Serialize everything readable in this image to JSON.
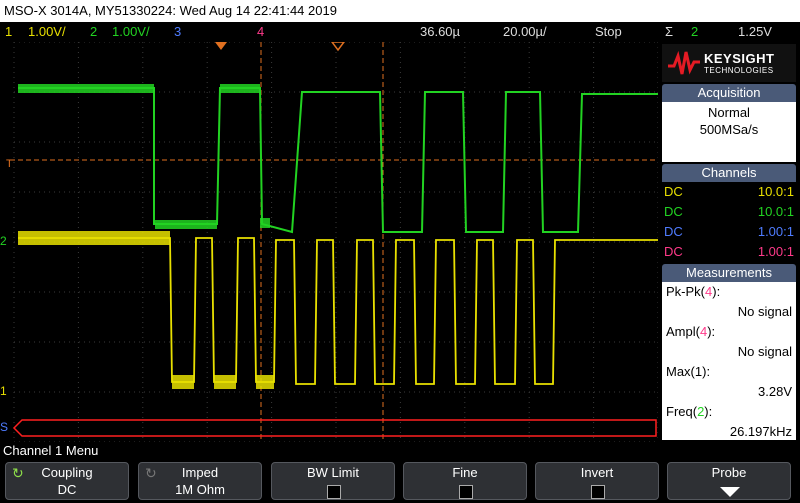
{
  "title": "MSO-X 3014A, MY51330224: Wed Aug 14 22:41:44 2019",
  "status": {
    "ch1_num": "1",
    "ch1_scale": "1.00V/",
    "ch2_num": "2",
    "ch2_scale": "1.00V/",
    "ch3_num": "3",
    "ch4_num": "4",
    "time_pos": "36.60µ",
    "time_scale": "20.00µ/",
    "run_state": "Stop",
    "trigger_icon": "Σ",
    "trigger_src": "2",
    "trigger_level": "1.25V"
  },
  "markers": {
    "trig": "T",
    "ch2": "2",
    "ch1": "1",
    "serial": "S"
  },
  "logo": {
    "brand": "KEYSIGHT",
    "sub": "TECHNOLOGIES",
    "icon": "keysight-wave-icon"
  },
  "acquisition": {
    "header": "Acquisition",
    "mode": "Normal",
    "rate": "500MSa/s"
  },
  "channels": {
    "header": "Channels",
    "rows": [
      {
        "coupling": "DC",
        "probe": "10.0:1",
        "color": "#e8e000"
      },
      {
        "coupling": "DC",
        "probe": "10.0:1",
        "color": "#22d322"
      },
      {
        "coupling": "DC",
        "probe": "1.00:1",
        "color": "#4f7cff"
      },
      {
        "coupling": "DC",
        "probe": "1.00:1",
        "color": "#ff3a8a"
      }
    ]
  },
  "measurements": {
    "header": "Measurements",
    "items": [
      {
        "label": "Pk-Pk(",
        "src": "4",
        "value": "No signal"
      },
      {
        "label": "Ampl(",
        "src": "4",
        "value": "No signal"
      },
      {
        "label": "Max(",
        "src": "1",
        "value": "3.28V"
      },
      {
        "label": "Freq(",
        "src": "2",
        "value": "26.197kHz"
      }
    ]
  },
  "menu": {
    "title": "Channel 1 Menu",
    "coupling": {
      "label": "Coupling",
      "value": "DC"
    },
    "imped": {
      "label": "Imped",
      "value": "1M Ohm"
    },
    "bw_limit": {
      "label": "BW Limit"
    },
    "fine": {
      "label": "Fine"
    },
    "invert": {
      "label": "Invert"
    },
    "probe": {
      "label": "Probe"
    }
  },
  "colors": {
    "ch1": "#e8e000",
    "ch2": "#22d322",
    "ch3": "#4f7cff",
    "ch4": "#ff3a8a",
    "grid": "#3a3a3a",
    "cursor": "#e07020"
  }
}
